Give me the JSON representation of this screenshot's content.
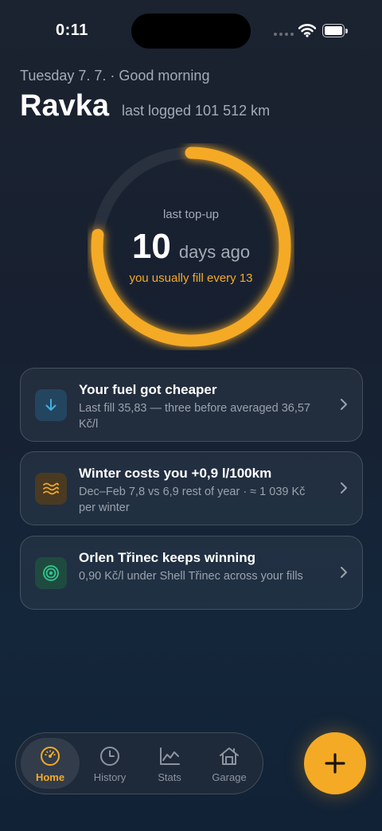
{
  "status_bar": {
    "time": "0:11"
  },
  "header": {
    "greeting": "Tuesday 7. 7. · Good morning",
    "vehicle_name": "Ravka",
    "odometer": "last logged 101 512 km"
  },
  "fill_ring": {
    "caption": "last top-up",
    "value": "10",
    "unit": "days ago",
    "subtitle": "you usually fill every 13",
    "progress_fraction": 0.77,
    "color": "#f5aa25"
  },
  "insights": [
    {
      "title": "Your fuel got cheaper",
      "body": "Last fill 35,83 — three before averaged 36,57 Kč/l",
      "icon": "arrow-down-icon",
      "color": "#3fb0e0"
    },
    {
      "title": "Winter costs you +0,9 l/100km",
      "body": "Dec–Feb 7,8 vs 6,9 rest of year · ≈ 1 039 Kč per winter",
      "icon": "waves-icon",
      "color": "#f5aa25"
    },
    {
      "title": "Orlen Třinec keeps winning",
      "body": "0,90 Kč/l under Shell Třinec across your fills",
      "icon": "target-icon",
      "color": "#2fc78e"
    }
  ],
  "tabs": [
    {
      "label": "Home",
      "icon": "gauge-icon",
      "active": true
    },
    {
      "label": "History",
      "icon": "clock-icon",
      "active": false
    },
    {
      "label": "Stats",
      "icon": "chart-icon",
      "active": false
    },
    {
      "label": "Garage",
      "icon": "garage-icon",
      "active": false
    }
  ],
  "fab": {
    "icon": "plus-icon"
  }
}
